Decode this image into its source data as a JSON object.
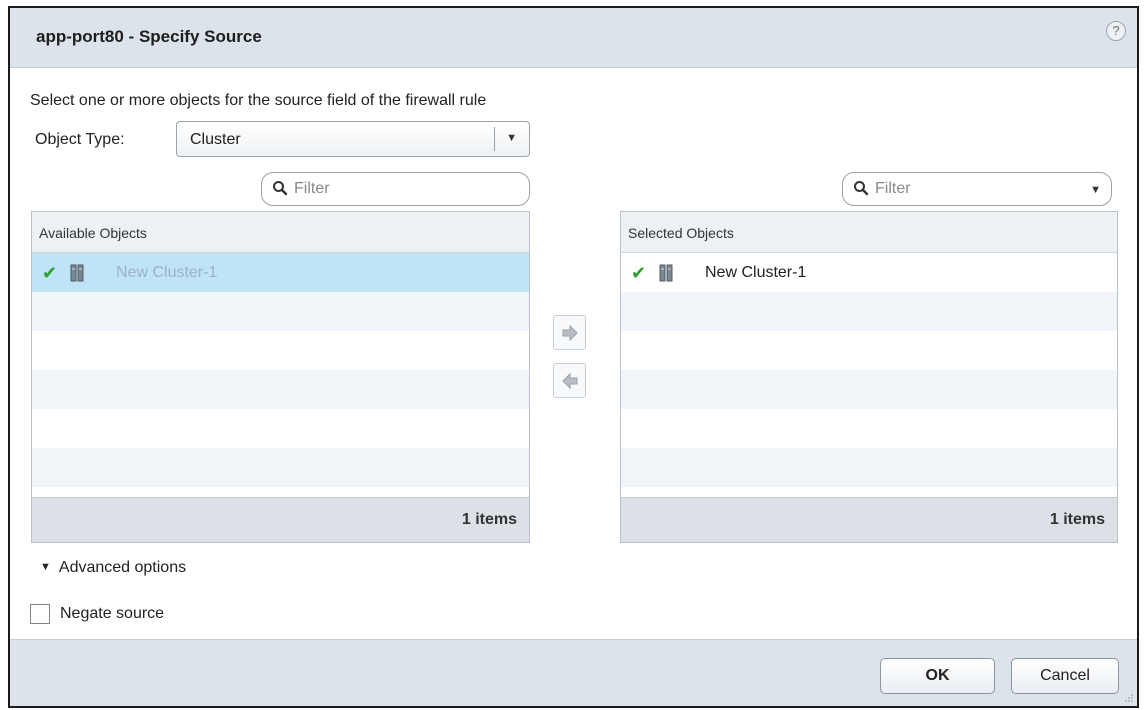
{
  "dialog": {
    "title": "app-port80 - Specify Source",
    "help_icon": "?",
    "instructions": "Select one or more objects for the source field of the firewall rule"
  },
  "object_type": {
    "label": "Object Type:",
    "value": "Cluster"
  },
  "available": {
    "filter_placeholder": "Filter",
    "header": "Available Objects",
    "items": [
      {
        "label": "New Cluster-1",
        "checked": true,
        "selected": true
      }
    ],
    "count": "1 items"
  },
  "selected": {
    "filter_placeholder": "Filter",
    "header": "Selected Objects",
    "items": [
      {
        "label": "New Cluster-1",
        "checked": true
      }
    ],
    "count": "1 items"
  },
  "advanced_options": "Advanced options",
  "negate_source": {
    "label": "Negate source",
    "checked": false
  },
  "buttons": {
    "ok": "OK",
    "cancel": "Cancel"
  },
  "colors": {
    "titlebar": "#dce3ea",
    "selected_row": "#bfe3f7",
    "check": "#2e9f2e"
  }
}
